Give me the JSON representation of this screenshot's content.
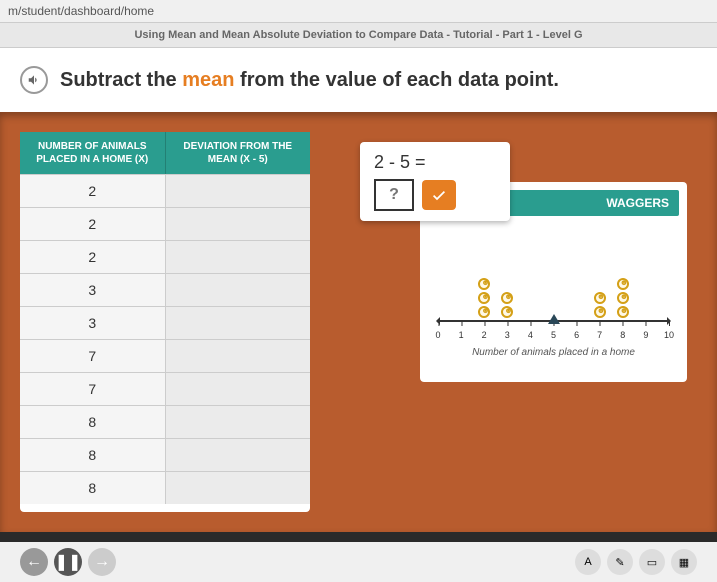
{
  "url": "m/student/dashboard/home",
  "header": "Using Mean and Mean Absolute Deviation to Compare Data - Tutorial - Part 1 - Level G",
  "instruction": {
    "pre": "Subtract the ",
    "mean": "mean",
    "post": " from the value of each data point."
  },
  "table": {
    "col1_header": "NUMBER OF ANIMALS PLACED IN A HOME (X)",
    "col2_header": "DEVIATION FROM THE MEAN (X - 5)",
    "rows": [
      "2",
      "2",
      "2",
      "3",
      "3",
      "7",
      "7",
      "8",
      "8",
      "8"
    ]
  },
  "equation": {
    "expr": "2 - 5 =",
    "placeholder": "?"
  },
  "dotplot": {
    "title": "WAGGERS",
    "axis_label": "Number of animals placed in a home",
    "ticks": [
      "0",
      "1",
      "2",
      "3",
      "4",
      "5",
      "6",
      "7",
      "8",
      "9",
      "10"
    ],
    "mean_at": 5
  },
  "chart_data": {
    "type": "dotplot",
    "title": "WAGGERS",
    "xlabel": "Number of animals placed in a home",
    "x_ticks": [
      0,
      1,
      2,
      3,
      4,
      5,
      6,
      7,
      8,
      9,
      10
    ],
    "values": [
      2,
      2,
      2,
      3,
      3,
      7,
      7,
      8,
      8,
      8
    ],
    "stacks": [
      {
        "x": 2,
        "count": 3
      },
      {
        "x": 3,
        "count": 2
      },
      {
        "x": 7,
        "count": 2
      },
      {
        "x": 8,
        "count": 3
      }
    ],
    "mean": 5,
    "xlim": [
      0,
      10
    ]
  }
}
